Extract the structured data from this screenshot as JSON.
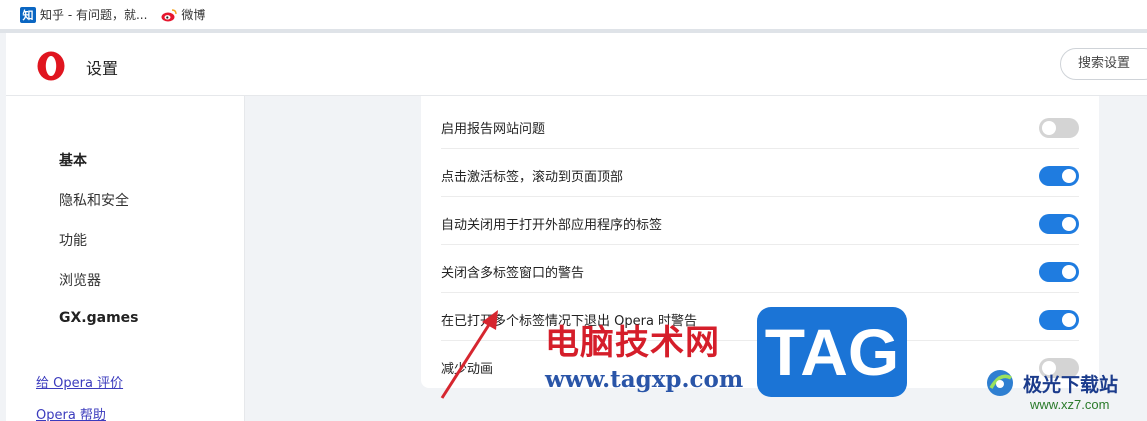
{
  "bookmarks": [
    {
      "icon": "zhihu-icon",
      "icon_text": "知",
      "label": "知乎 - 有问题，就..."
    },
    {
      "icon": "weibo-icon",
      "label": "微博"
    }
  ],
  "header": {
    "title": "设置",
    "search_label": "搜索设置"
  },
  "sidebar": {
    "items": [
      {
        "label": "基本",
        "active": true
      },
      {
        "label": "隐私和安全",
        "active": false
      },
      {
        "label": "功能",
        "active": false
      },
      {
        "label": "浏览器",
        "active": false
      },
      {
        "label": "GX.games",
        "active": false
      }
    ],
    "links": [
      "给 Opera 评价",
      "Opera 帮助"
    ]
  },
  "settings": [
    {
      "label": "启用报告网站问题",
      "enabled": false
    },
    {
      "label": "点击激活标签，滚动到页面顶部",
      "enabled": true
    },
    {
      "label": "自动关闭用于打开外部应用程序的标签",
      "enabled": true
    },
    {
      "label": "关闭含多标签窗口的警告",
      "enabled": true
    },
    {
      "label": "在已打开多个标签情况下退出 Opera 时警告",
      "enabled": true
    },
    {
      "label": "减少动画",
      "enabled": false
    }
  ],
  "watermark": {
    "cn_text": "电脑技术网",
    "url": "www.tagxp.com",
    "tag": "TAG",
    "site_name": "极光下载站",
    "site_url": "www.xz7.com"
  },
  "colors": {
    "accent": "#1f7ce0",
    "toggle_off": "#d4d4d4",
    "opera_red": "#e0151f"
  }
}
